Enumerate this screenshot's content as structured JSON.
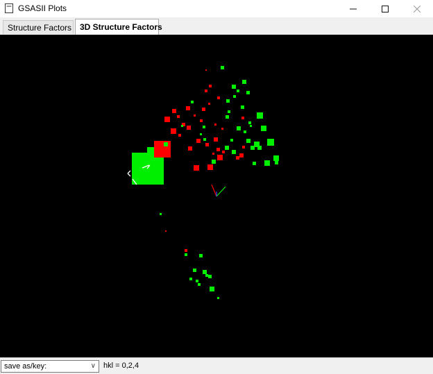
{
  "window": {
    "title": "GSASII Plots",
    "close_color": "#999999"
  },
  "tabs": [
    {
      "label": "Structure Factors",
      "active": false
    },
    {
      "label": "3D Structure Factors",
      "active": true
    }
  ],
  "plot": {
    "background": "#000000",
    "colors": {
      "positive": "#00ee00",
      "negative": "#ff0000"
    }
  },
  "status": {
    "save_label": "save as/key:",
    "hkl_text": "hkl = 0,2,4"
  }
}
